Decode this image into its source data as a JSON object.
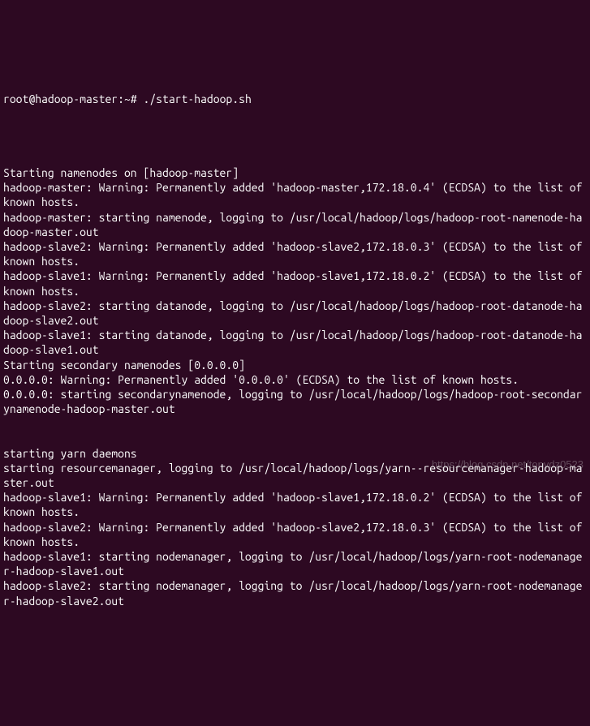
{
  "prompt": {
    "user_host": "root@hadoop-master",
    "path": "~",
    "separator1": ":",
    "separator2": "#",
    "command": "./start-hadoop.sh"
  },
  "output_lines": [
    "",
    "",
    "Starting namenodes on [hadoop-master]",
    "hadoop-master: Warning: Permanently added 'hadoop-master,172.18.0.4' (ECDSA) to the list of known hosts.",
    "hadoop-master: starting namenode, logging to /usr/local/hadoop/logs/hadoop-root-namenode-hadoop-master.out",
    "hadoop-slave2: Warning: Permanently added 'hadoop-slave2,172.18.0.3' (ECDSA) to the list of known hosts.",
    "hadoop-slave1: Warning: Permanently added 'hadoop-slave1,172.18.0.2' (ECDSA) to the list of known hosts.",
    "hadoop-slave2: starting datanode, logging to /usr/local/hadoop/logs/hadoop-root-datanode-hadoop-slave2.out",
    "hadoop-slave1: starting datanode, logging to /usr/local/hadoop/logs/hadoop-root-datanode-hadoop-slave1.out",
    "Starting secondary namenodes [0.0.0.0]",
    "0.0.0.0: Warning: Permanently added '0.0.0.0' (ECDSA) to the list of known hosts.",
    "0.0.0.0: starting secondarynamenode, logging to /usr/local/hadoop/logs/hadoop-root-secondarynamenode-hadoop-master.out",
    "",
    "",
    "starting yarn daemons",
    "starting resourcemanager, logging to /usr/local/hadoop/logs/yarn--resourcemanager-hadoop-master.out",
    "hadoop-slave1: Warning: Permanently added 'hadoop-slave1,172.18.0.2' (ECDSA) to the list of known hosts.",
    "hadoop-slave2: Warning: Permanently added 'hadoop-slave2,172.18.0.3' (ECDSA) to the list of known hosts.",
    "hadoop-slave1: starting nodemanager, logging to /usr/local/hadoop/logs/yarn-root-nodemanager-hadoop-slave1.out",
    "hadoop-slave2: starting nodemanager, logging to /usr/local/hadoop/logs/yarn-root-nodemanager-hadoop-slave2.out"
  ],
  "watermark_text": "https://blog.csdn.net/tonydz0523"
}
